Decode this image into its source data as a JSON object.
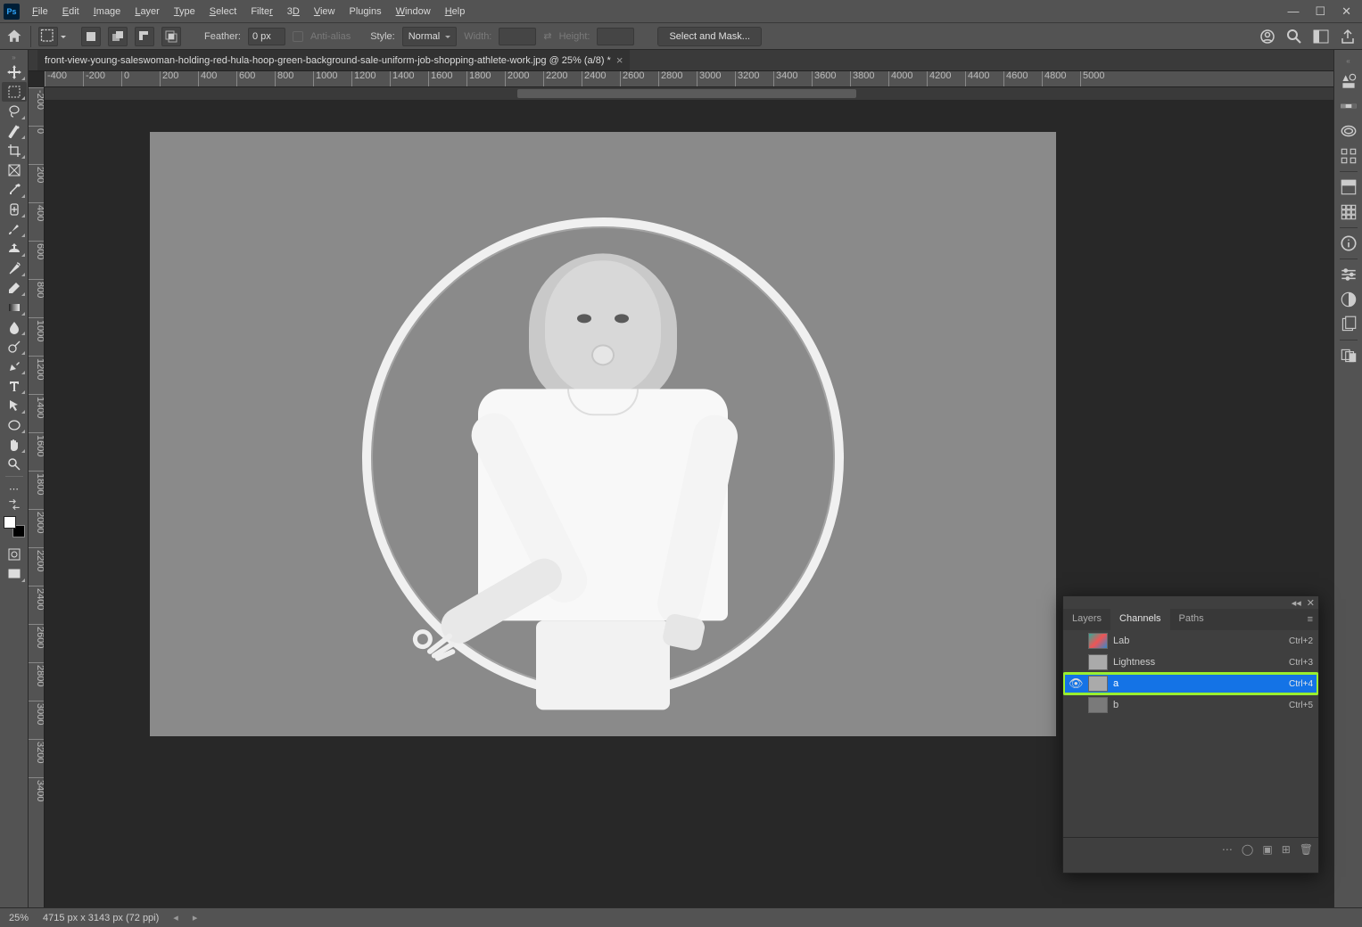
{
  "app": {
    "logo": "Ps"
  },
  "menu": [
    "File",
    "Edit",
    "Image",
    "Layer",
    "Type",
    "Select",
    "Filter",
    "3D",
    "View",
    "Plugins",
    "Window",
    "Help"
  ],
  "options": {
    "feather_label": "Feather:",
    "feather_value": "0 px",
    "antialias": "Anti-alias",
    "style_label": "Style:",
    "style_value": "Normal",
    "width_label": "Width:",
    "width_value": "",
    "height_label": "Height:",
    "height_value": "",
    "mask_btn": "Select and Mask..."
  },
  "document": {
    "tab_title": "front-view-young-saleswoman-holding-red-hula-hoop-green-background-sale-uniform-job-shopping-athlete-work.jpg @ 25% (a/8) *"
  },
  "ruler_h": [
    "-400",
    "-200",
    "0",
    "200",
    "400",
    "600",
    "800",
    "1000",
    "1200",
    "1400",
    "1600",
    "1800",
    "2000",
    "2200",
    "2400",
    "2600",
    "2800",
    "3000",
    "3200",
    "3400",
    "3600",
    "3800",
    "4000",
    "4200",
    "4400",
    "4600",
    "4800",
    "5000"
  ],
  "ruler_v": [
    "-200",
    "0",
    "200",
    "400",
    "600",
    "800",
    "1000",
    "1200",
    "1400",
    "1600",
    "1800",
    "2000",
    "2200",
    "2400",
    "2600",
    "2800",
    "3000",
    "3200",
    "3400"
  ],
  "footer": {
    "zoom": "25%",
    "docinfo": "4715 px x 3143 px (72 ppi)"
  },
  "panel": {
    "tabs": [
      "Layers",
      "Channels",
      "Paths"
    ],
    "active_tab": 1,
    "channels": [
      {
        "eye": "",
        "name": "Lab",
        "shortcut": "Ctrl+2",
        "thumb": "lab"
      },
      {
        "eye": "",
        "name": "Lightness",
        "shortcut": "Ctrl+3",
        "thumb": "grey"
      },
      {
        "eye": "●",
        "name": "a",
        "shortcut": "Ctrl+4",
        "thumb": "grey",
        "selected": true
      },
      {
        "eye": "",
        "name": "b",
        "shortcut": "Ctrl+5",
        "thumb": "dk"
      }
    ]
  }
}
